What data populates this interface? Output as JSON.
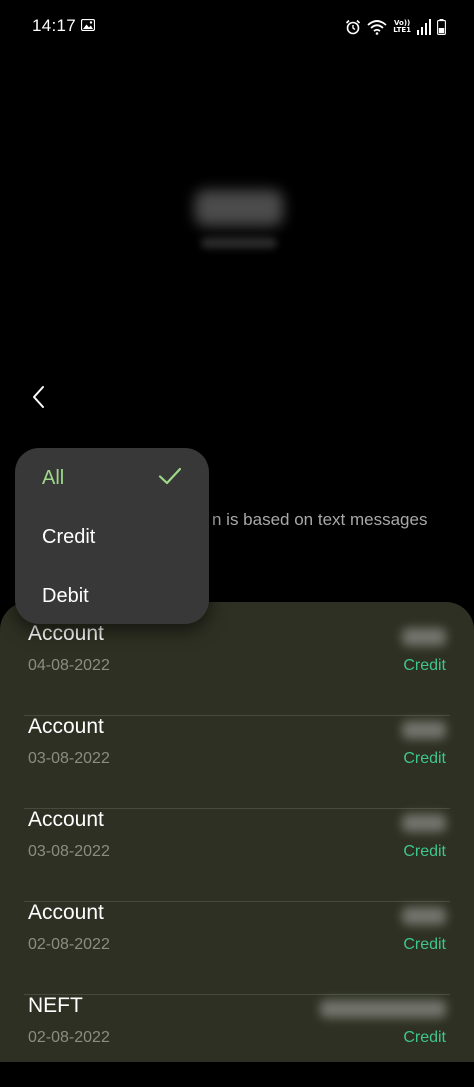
{
  "status_bar": {
    "time": "14:17",
    "volte_line1": "Vo))",
    "volte_line2": "LTE1",
    "icons": [
      "gallery-icon",
      "alarm-icon",
      "wifi-icon",
      "signal-icon",
      "battery-icon"
    ]
  },
  "header": {
    "back_icon": "chevron-left-icon"
  },
  "disclaimer": {
    "text_visible": "n is based on text messages"
  },
  "filter_menu": {
    "items": [
      {
        "label": "All",
        "selected": true
      },
      {
        "label": "Credit",
        "selected": false
      },
      {
        "label": "Debit",
        "selected": false
      }
    ],
    "selected_color": "#9ed98a"
  },
  "transactions": [
    {
      "title": "Account",
      "date": "04-08-2022",
      "type": "Credit"
    },
    {
      "title": "Account",
      "date": "03-08-2022",
      "type": "Credit"
    },
    {
      "title": "Account",
      "date": "03-08-2022",
      "type": "Credit"
    },
    {
      "title": "Account",
      "date": "02-08-2022",
      "type": "Credit"
    },
    {
      "title": "NEFT",
      "date": "02-08-2022",
      "type": "Credit"
    }
  ],
  "colors": {
    "background": "#000000",
    "sheet": "#2d3022",
    "credit_green": "#3fc68e",
    "menu": "#383838"
  }
}
